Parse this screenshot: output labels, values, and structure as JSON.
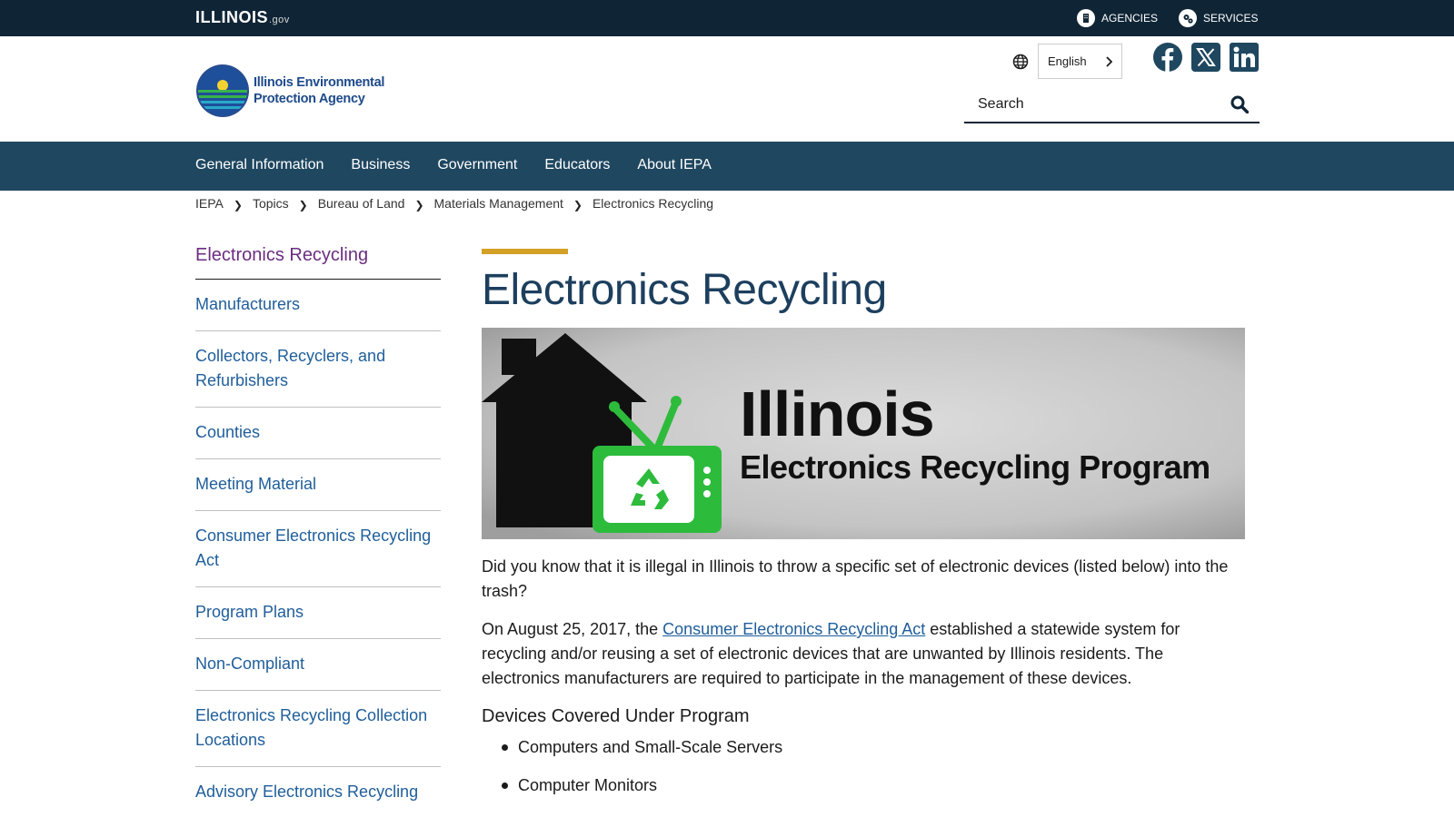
{
  "topbar": {
    "logo": "ILLINOIS",
    "logo_suffix": ".gov",
    "agencies": "AGENCIES",
    "services": "SERVICES"
  },
  "header": {
    "agency_name_line1": "Illinois Environmental",
    "agency_name_line2": "Protection Agency",
    "language": "English",
    "search_placeholder": "Search",
    "social": [
      "facebook-icon",
      "x-icon",
      "linkedin-icon"
    ]
  },
  "nav": {
    "items": [
      "General Information",
      "Business",
      "Government",
      "Educators",
      "About IEPA"
    ]
  },
  "breadcrumb": [
    "IEPA",
    "Topics",
    "Bureau of Land",
    "Materials Management",
    "Electronics Recycling"
  ],
  "sidebar": {
    "heading": "Electronics Recycling",
    "items": [
      "Manufacturers",
      "Collectors, Recyclers, and Refurbishers",
      "Counties",
      "Meeting Material",
      "Consumer Electronics Recycling Act",
      "Program Plans",
      "Non-Compliant",
      "Electronics Recycling Collection Locations",
      "Advisory Electronics Recycling"
    ]
  },
  "main": {
    "title": "Electronics Recycling",
    "hero_line1": "Illinois",
    "hero_line2": "Electronics Recycling Program",
    "para1": "Did you know that it is illegal in Illinois to throw a specific set of electronic devices (listed below) into the trash?",
    "para2_before": "On August 25, 2017, the ",
    "para2_link": "Consumer Electronics Recycling Act",
    "para2_after": " established a statewide system for recycling and/or reusing a set of electronic devices that are unwanted by Illinois residents. The electronics manufacturers are required to participate in the management of these devices.",
    "subheading": "Devices Covered Under Program",
    "devices": [
      "Computers and Small-Scale Servers",
      "Computer Monitors"
    ]
  },
  "colors": {
    "topbar": "#0f2536",
    "nav": "#1f4760",
    "link": "#1f5e9a",
    "sidebar_active": "#6b2d80",
    "accent": "#d4a026",
    "recycle_green": "#2dbb3c"
  }
}
